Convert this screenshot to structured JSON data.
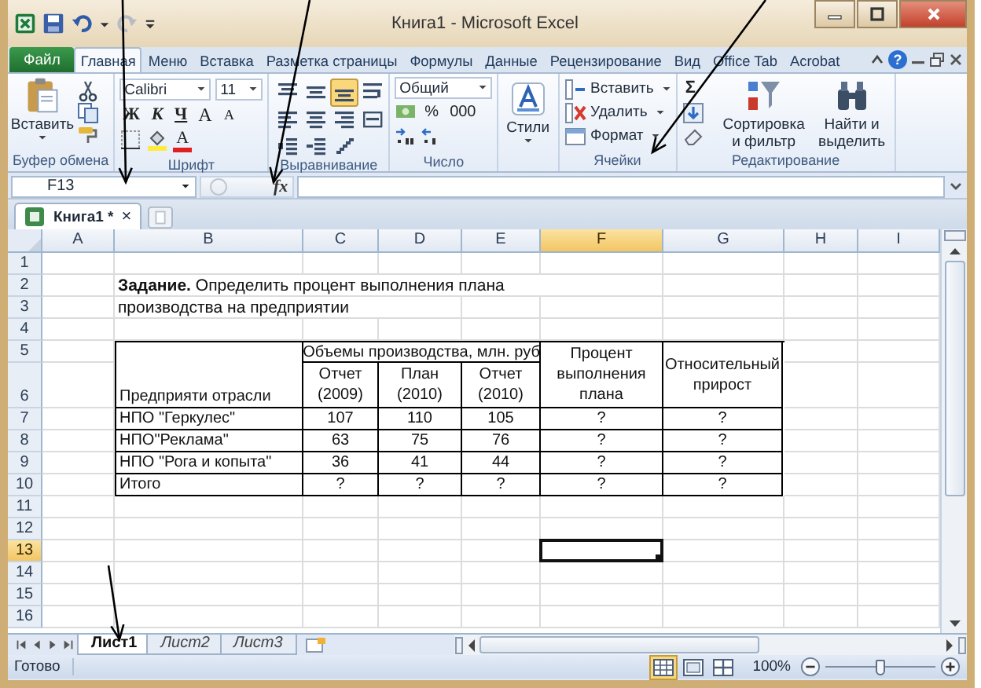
{
  "window": {
    "title": "Книга1 - Microsoft Excel"
  },
  "ribbon": {
    "tabs": [
      {
        "label": "Файл",
        "kind": "file",
        "selected": false
      },
      {
        "label": "Главная",
        "kind": "tab",
        "selected": true
      },
      {
        "label": "Меню",
        "kind": "tab",
        "selected": false
      },
      {
        "label": "Вставка",
        "kind": "tab",
        "selected": false
      },
      {
        "label": "Разметка страницы",
        "kind": "tab",
        "selected": false
      },
      {
        "label": "Формулы",
        "kind": "tab",
        "selected": false
      },
      {
        "label": "Данные",
        "kind": "tab",
        "selected": false
      },
      {
        "label": "Рецензирование",
        "kind": "tab",
        "selected": false
      },
      {
        "label": "Вид",
        "kind": "tab",
        "selected": false
      },
      {
        "label": "Office Tab",
        "kind": "tab",
        "selected": false
      },
      {
        "label": "Acrobat",
        "kind": "tab",
        "selected": false
      }
    ],
    "help": "?",
    "groups": [
      {
        "kind": "clipboard",
        "label": "Буфер обмена",
        "paste": "Вставить"
      },
      {
        "kind": "font",
        "label": "Шрифт",
        "font": "Calibri",
        "size": "11",
        "bold": "Ж",
        "italic": "К",
        "underline": "Ч",
        "grow": "A",
        "shrink": "A",
        "color_letter": "A"
      },
      {
        "kind": "alignment",
        "label": "Выравнивание",
        "toggles": [
          {
            "kind": "top",
            "selected": false
          },
          {
            "kind": "middle",
            "selected": false
          },
          {
            "kind": "bottom",
            "selected": true
          },
          {
            "kind": "wrap",
            "selected": false
          },
          {
            "kind": "left",
            "selected": false
          },
          {
            "kind": "center",
            "selected": false
          },
          {
            "kind": "right",
            "selected": false
          },
          {
            "kind": "merge",
            "selected": false
          },
          {
            "kind": "outdent",
            "selected": false
          },
          {
            "kind": "indent",
            "selected": false
          },
          {
            "kind": "orientation",
            "selected": false
          }
        ]
      },
      {
        "kind": "number",
        "label": "Число",
        "format": "Общий",
        "percent": "%",
        "thousands": "000"
      },
      {
        "kind": "styles",
        "button": "Стили"
      },
      {
        "kind": "cells",
        "label": "Ячейки",
        "buttons": [
          {
            "kind": "insert",
            "label": "Вставить"
          },
          {
            "kind": "delete",
            "label": "Удалить"
          },
          {
            "kind": "format",
            "label": "Формат"
          }
        ]
      },
      {
        "kind": "editing",
        "label": "Редактирование",
        "sum": "Σ",
        "sort": "Сортировка и фильтр",
        "find": "Найти и выделить"
      }
    ]
  },
  "formula_bar": {
    "name_box": "F13",
    "fx": "fx"
  },
  "doc_tabs": [
    {
      "label": "Книга1 *",
      "close": "×",
      "selected": true
    }
  ],
  "sheet": {
    "columns": [
      {
        "label": "A",
        "selected": false
      },
      {
        "label": "B",
        "selected": false
      },
      {
        "label": "C",
        "selected": false
      },
      {
        "label": "D",
        "selected": false
      },
      {
        "label": "E",
        "selected": false
      },
      {
        "label": "F",
        "selected": true
      },
      {
        "label": "G",
        "selected": false
      },
      {
        "label": "H",
        "selected": false
      },
      {
        "label": "I",
        "selected": false
      }
    ],
    "rows": [
      {
        "label": "1",
        "selected": false
      },
      {
        "label": "2",
        "selected": false
      },
      {
        "label": "3",
        "selected": false
      },
      {
        "label": "4",
        "selected": false
      },
      {
        "label": "5",
        "selected": false
      },
      {
        "label": "6",
        "selected": false
      },
      {
        "label": "7",
        "selected": false
      },
      {
        "label": "8",
        "selected": false
      },
      {
        "label": "9",
        "selected": false
      },
      {
        "label": "10",
        "selected": false
      },
      {
        "label": "11",
        "selected": false
      },
      {
        "label": "12",
        "selected": false
      },
      {
        "label": "13",
        "selected": true
      },
      {
        "label": "14",
        "selected": false
      },
      {
        "label": "15",
        "selected": false
      },
      {
        "label": "16",
        "selected": false
      }
    ],
    "task": [
      "**Задание.** Определить процент выполнения плана",
      "производства на предприятии"
    ],
    "table": {
      "group_header": "Объемы производства, млн. руб",
      "headers": [
        "Предприяти отрасли",
        "Отчет (2009)",
        "План (2010)",
        "Отчет (2010)",
        "Процент выполнения плана",
        "Относительный прирост"
      ],
      "rows": [
        [
          "НПО \"Геркулес\"",
          "107",
          "110",
          "105",
          "?",
          "?"
        ],
        [
          "НПО\"Реклама\"",
          "63",
          "75",
          "76",
          "?",
          "?"
        ],
        [
          "НПО \"Рога и копыта\"",
          "36",
          "41",
          "44",
          "?",
          "?"
        ],
        [
          "Итого",
          "?",
          "?",
          "?",
          "?",
          "?"
        ]
      ]
    }
  },
  "sheet_tabs": [
    {
      "label": "Лист1",
      "selected": true
    },
    {
      "label": "Лист2",
      "selected": false
    },
    {
      "label": "Лист3",
      "selected": false
    }
  ],
  "status_bar": {
    "text": "Готово",
    "views": [
      {
        "kind": "normal",
        "selected": true
      },
      {
        "kind": "page_layout",
        "selected": false
      },
      {
        "kind": "page_break",
        "selected": false
      }
    ],
    "zoom": "100%",
    "zoom_slider": {
      "level": 0.5
    }
  }
}
